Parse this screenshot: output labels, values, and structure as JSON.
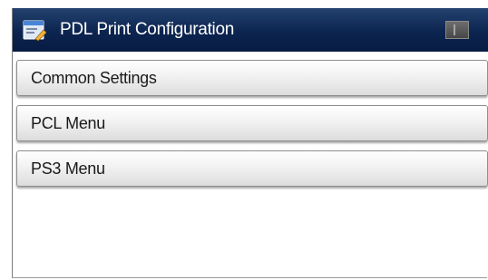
{
  "header": {
    "title": "PDL Print Configuration",
    "icon": "settings-document-icon",
    "accent_color": "#0c2450"
  },
  "menu": {
    "items": [
      {
        "label": "Common Settings"
      },
      {
        "label": "PCL Menu"
      },
      {
        "label": "PS3 Menu"
      }
    ]
  }
}
